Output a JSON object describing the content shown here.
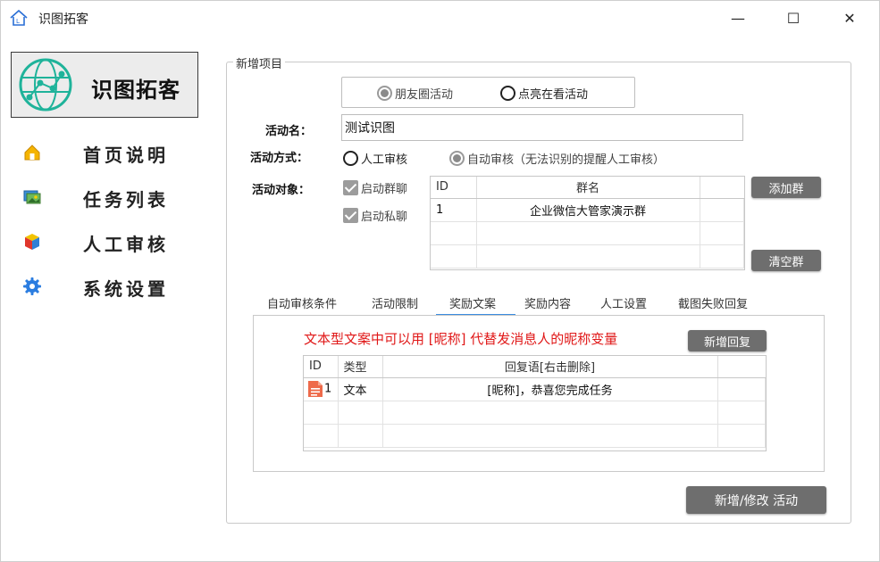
{
  "window": {
    "title": "识图拓客",
    "minimize_glyph": "—",
    "maximize_glyph": "☐",
    "close_glyph": "✕"
  },
  "sidebar": {
    "logo_text": "识图拓客",
    "items": [
      {
        "label": "首页说明",
        "icon": "home-icon"
      },
      {
        "label": "任务列表",
        "icon": "image-stack-icon"
      },
      {
        "label": "人工审核",
        "icon": "cube-icon"
      },
      {
        "label": "系统设置",
        "icon": "gear-icon"
      }
    ]
  },
  "form": {
    "group_title": "新增项目",
    "activity_source": {
      "options": [
        "朋友圈活动",
        "点亮在看活动"
      ],
      "selected": "朋友圈活动"
    },
    "name_label": "活动名：",
    "name_value": "测试识图",
    "mode_label": "活动方式：",
    "mode_options": [
      "人工审核",
      "自动审核（无法识别的提醒人工审核）"
    ],
    "mode_selected": "自动审核（无法识别的提醒人工审核）",
    "target_label": "活动对象：",
    "targets": [
      {
        "label": "启动群聊",
        "checked": true
      },
      {
        "label": "启动私聊",
        "checked": true
      }
    ],
    "group_table": {
      "headers": [
        "ID",
        "群名"
      ],
      "rows": [
        {
          "id": "1",
          "name": "企业微信大管家演示群"
        }
      ]
    },
    "add_group_button": "添加群",
    "clear_group_button": "清空群"
  },
  "tabs": {
    "items": [
      "自动审核条件",
      "活动限制",
      "奖励文案",
      "奖励内容",
      "人工设置",
      "截图失败回复"
    ],
    "active": "奖励文案"
  },
  "reward_panel": {
    "note": "文本型文案中可以用 [昵称] 代替发消息人的昵称变量",
    "new_reply_button": "新增回复",
    "table": {
      "headers": [
        "ID",
        "类型",
        "回复语[右击删除]"
      ],
      "rows": [
        {
          "id": "1",
          "type": "文本",
          "reply": "[昵称]，恭喜您完成任务"
        }
      ]
    }
  },
  "submit_button": "新增/修改 活动",
  "colors": {
    "accent_teal": "#1fb39a",
    "button_gray": "#6e6e6e",
    "note_red": "#e01818",
    "tab_active": "#3b8de0"
  }
}
